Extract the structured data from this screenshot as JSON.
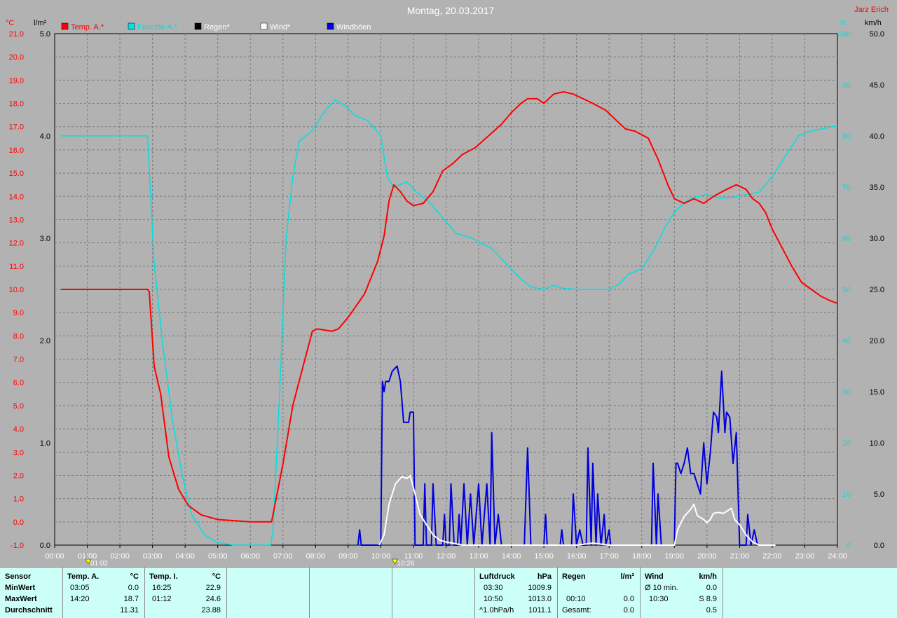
{
  "title": "Montag, 20.03.2017",
  "author": "Jarz Erich",
  "axes": {
    "left_temp": {
      "unit": "°C",
      "ticks": [
        "21.0",
        "20.0",
        "19.0",
        "18.0",
        "17.0",
        "16.0",
        "15.0",
        "14.0",
        "13.0",
        "12.0",
        "11.0",
        "10.0",
        "9.0",
        "8.0",
        "7.0",
        "6.0",
        "5.0",
        "4.0",
        "3.0",
        "2.0",
        "1.0",
        "0.0",
        "-1.0"
      ]
    },
    "left_rain": {
      "unit": "l/m²",
      "ticks": [
        "5.0",
        "4.0",
        "3.0",
        "2.0",
        "1.0",
        "0.0"
      ]
    },
    "right_hum": {
      "unit": "%",
      "ticks": [
        "100",
        "90",
        "80",
        "70",
        "60",
        "50",
        "40",
        "30",
        "20",
        "10",
        "0"
      ]
    },
    "right_wind": {
      "unit": "km/h",
      "ticks": [
        "50.0",
        "45.0",
        "40.0",
        "35.0",
        "30.0",
        "25.0",
        "20.0",
        "15.0",
        "10.0",
        "5.0",
        "0.0"
      ]
    },
    "x_ticks": [
      "00:00",
      "01:00",
      "02:00",
      "03:00",
      "04:00",
      "05:00",
      "06:00",
      "07:00",
      "08:00",
      "09:00",
      "10:00",
      "11:00",
      "12:00",
      "13:00",
      "14:00",
      "15:00",
      "16:00",
      "17:00",
      "18:00",
      "19:00",
      "20:00",
      "21:00",
      "22:00",
      "23:00",
      "24:00"
    ]
  },
  "markers": [
    {
      "label": "01:02",
      "hour": 1.03
    },
    {
      "label": "10:26",
      "hour": 10.43
    }
  ],
  "colors": {
    "temp": "#ff0000",
    "hum": "#00e0e0",
    "rain": "#000000",
    "wind": "#ffffff",
    "gust": "#0000dd",
    "grid": "#7a7a7a",
    "plot_bg": "#b2b2b2"
  },
  "chart_data": {
    "type": "line",
    "title": "Montag, 20.03.2017",
    "xlim": [
      0,
      24
    ],
    "legend": "top",
    "grid": true,
    "series": [
      {
        "name": "Temp. A.*",
        "axis": "temp",
        "ylim": [
          -1,
          21
        ],
        "points": [
          [
            0.2,
            10.0
          ],
          [
            2.85,
            10.0
          ],
          [
            2.9,
            9.9
          ],
          [
            3.05,
            6.7
          ],
          [
            3.25,
            5.5
          ],
          [
            3.5,
            2.8
          ],
          [
            3.8,
            1.4
          ],
          [
            4.1,
            0.7
          ],
          [
            4.5,
            0.3
          ],
          [
            5,
            0.1
          ],
          [
            6,
            0.0
          ],
          [
            6.65,
            0.0
          ],
          [
            7.0,
            2.5
          ],
          [
            7.3,
            5.0
          ],
          [
            7.6,
            6.6
          ],
          [
            7.9,
            8.2
          ],
          [
            8.05,
            8.3
          ],
          [
            8.5,
            8.2
          ],
          [
            8.7,
            8.3
          ],
          [
            9.0,
            8.8
          ],
          [
            9.5,
            9.8
          ],
          [
            9.9,
            11.2
          ],
          [
            10.1,
            12.3
          ],
          [
            10.25,
            13.8
          ],
          [
            10.4,
            14.5
          ],
          [
            10.6,
            14.2
          ],
          [
            10.8,
            13.8
          ],
          [
            11.0,
            13.6
          ],
          [
            11.3,
            13.7
          ],
          [
            11.6,
            14.2
          ],
          [
            11.9,
            15.1
          ],
          [
            12.2,
            15.4
          ],
          [
            12.5,
            15.8
          ],
          [
            12.9,
            16.1
          ],
          [
            13.3,
            16.6
          ],
          [
            13.7,
            17.1
          ],
          [
            14.0,
            17.6
          ],
          [
            14.3,
            18.0
          ],
          [
            14.5,
            18.2
          ],
          [
            14.8,
            18.2
          ],
          [
            15.0,
            18.0
          ],
          [
            15.3,
            18.4
          ],
          [
            15.6,
            18.5
          ],
          [
            15.9,
            18.4
          ],
          [
            16.2,
            18.2
          ],
          [
            16.5,
            18.0
          ],
          [
            16.9,
            17.7
          ],
          [
            17.2,
            17.3
          ],
          [
            17.5,
            16.9
          ],
          [
            17.8,
            16.8
          ],
          [
            18.2,
            16.5
          ],
          [
            18.5,
            15.6
          ],
          [
            18.8,
            14.5
          ],
          [
            19.0,
            13.9
          ],
          [
            19.3,
            13.7
          ],
          [
            19.6,
            13.9
          ],
          [
            19.9,
            13.7
          ],
          [
            20.2,
            14.0
          ],
          [
            20.6,
            14.3
          ],
          [
            20.9,
            14.5
          ],
          [
            21.2,
            14.3
          ],
          [
            21.4,
            13.9
          ],
          [
            21.6,
            13.7
          ],
          [
            21.8,
            13.3
          ],
          [
            22.0,
            12.6
          ],
          [
            22.3,
            11.8
          ],
          [
            22.6,
            11.0
          ],
          [
            22.9,
            10.3
          ],
          [
            23.2,
            10.0
          ],
          [
            23.5,
            9.7
          ],
          [
            23.8,
            9.5
          ],
          [
            24.0,
            9.4
          ]
        ]
      },
      {
        "name": "Feuchte A.*",
        "axis": "hum",
        "ylim": [
          0,
          100
        ],
        "points": [
          [
            0.2,
            80.0
          ],
          [
            2.85,
            80.0
          ],
          [
            3.05,
            55
          ],
          [
            3.3,
            40
          ],
          [
            3.6,
            25
          ],
          [
            3.9,
            14
          ],
          [
            4.2,
            6
          ],
          [
            4.6,
            2
          ],
          [
            5.0,
            0.5
          ],
          [
            5.5,
            0
          ],
          [
            6.62,
            0
          ],
          [
            6.7,
            3
          ],
          [
            6.9,
            30
          ],
          [
            7.1,
            60
          ],
          [
            7.3,
            72
          ],
          [
            7.5,
            79
          ],
          [
            7.9,
            81
          ],
          [
            8.3,
            85
          ],
          [
            8.6,
            87
          ],
          [
            8.9,
            86
          ],
          [
            9.2,
            84
          ],
          [
            9.6,
            83
          ],
          [
            10.0,
            80
          ],
          [
            10.2,
            72
          ],
          [
            10.4,
            70
          ],
          [
            10.8,
            71
          ],
          [
            11.1,
            69
          ],
          [
            11.5,
            67
          ],
          [
            11.9,
            64
          ],
          [
            12.3,
            61
          ],
          [
            12.8,
            60
          ],
          [
            13.1,
            59
          ],
          [
            13.4,
            58
          ],
          [
            13.7,
            56
          ],
          [
            14.0,
            54
          ],
          [
            14.3,
            52
          ],
          [
            14.6,
            50.5
          ],
          [
            15.0,
            50
          ],
          [
            15.3,
            50.8
          ],
          [
            15.6,
            50.2
          ],
          [
            16.0,
            50
          ],
          [
            16.5,
            50
          ],
          [
            17.0,
            50
          ],
          [
            17.3,
            51
          ],
          [
            17.6,
            53
          ],
          [
            18.0,
            54
          ],
          [
            18.4,
            58
          ],
          [
            18.7,
            62
          ],
          [
            19.0,
            65
          ],
          [
            19.3,
            67
          ],
          [
            19.6,
            68
          ],
          [
            20.0,
            68.5
          ],
          [
            20.4,
            67.8
          ],
          [
            20.8,
            68
          ],
          [
            21.2,
            68.5
          ],
          [
            21.6,
            69
          ],
          [
            22.0,
            72
          ],
          [
            22.4,
            76
          ],
          [
            22.8,
            80
          ],
          [
            23.2,
            81
          ],
          [
            23.6,
            81.5
          ],
          [
            24.0,
            82
          ]
        ]
      },
      {
        "name": "Regen*",
        "axis": "rain",
        "ylim": [
          0,
          5
        ],
        "points": []
      },
      {
        "name": "Wind*",
        "axis": "wind",
        "ylim": [
          0,
          50
        ],
        "points": [
          [
            9.95,
            0
          ],
          [
            10.1,
            1
          ],
          [
            10.25,
            4
          ],
          [
            10.45,
            6
          ],
          [
            10.65,
            6.7
          ],
          [
            10.8,
            6.5
          ],
          [
            10.9,
            6.8
          ],
          [
            11.05,
            5
          ],
          [
            11.2,
            3
          ],
          [
            11.4,
            2
          ],
          [
            11.6,
            1
          ],
          [
            11.8,
            0.5
          ],
          [
            12.0,
            0.3
          ],
          [
            12.2,
            0.2
          ],
          [
            12.5,
            0
          ],
          [
            13.4,
            0
          ],
          [
            14.0,
            0
          ],
          [
            14.5,
            0
          ],
          [
            15.0,
            0
          ],
          [
            16.0,
            0
          ],
          [
            16.5,
            0.2
          ],
          [
            17.0,
            0
          ],
          [
            19.0,
            0
          ],
          [
            19.1,
            1.5
          ],
          [
            19.3,
            2.8
          ],
          [
            19.5,
            3.5
          ],
          [
            19.6,
            4.0
          ],
          [
            19.7,
            2.9
          ],
          [
            19.9,
            2.5
          ],
          [
            20.0,
            2.2
          ],
          [
            20.1,
            2.5
          ],
          [
            20.2,
            3.1
          ],
          [
            20.35,
            3.2
          ],
          [
            20.5,
            3.1
          ],
          [
            20.6,
            3.3
          ],
          [
            20.75,
            3.6
          ],
          [
            20.85,
            2.5
          ],
          [
            21.0,
            2.0
          ],
          [
            21.2,
            1.0
          ],
          [
            21.4,
            0.3
          ],
          [
            21.6,
            0
          ],
          [
            22.1,
            0
          ]
        ]
      },
      {
        "name": "Windböen",
        "axis": "wind",
        "ylim": [
          0,
          50
        ],
        "points": [
          [
            9.3,
            0
          ],
          [
            9.35,
            1.5
          ],
          [
            9.4,
            0
          ],
          [
            10.0,
            0
          ],
          [
            10.05,
            16
          ],
          [
            10.1,
            15
          ],
          [
            10.15,
            16
          ],
          [
            10.25,
            16
          ],
          [
            10.35,
            17
          ],
          [
            10.5,
            17.5
          ],
          [
            10.6,
            16
          ],
          [
            10.7,
            12
          ],
          [
            10.85,
            12
          ],
          [
            10.9,
            13
          ],
          [
            11.0,
            13
          ],
          [
            11.05,
            0
          ],
          [
            11.3,
            0
          ],
          [
            11.35,
            6
          ],
          [
            11.4,
            0
          ],
          [
            11.55,
            0
          ],
          [
            11.6,
            6
          ],
          [
            11.7,
            0
          ],
          [
            11.9,
            0
          ],
          [
            11.95,
            3
          ],
          [
            12.0,
            0
          ],
          [
            12.1,
            0
          ],
          [
            12.15,
            6
          ],
          [
            12.25,
            0
          ],
          [
            12.35,
            0
          ],
          [
            12.4,
            3
          ],
          [
            12.45,
            0
          ],
          [
            12.55,
            6
          ],
          [
            12.65,
            0
          ],
          [
            12.75,
            5
          ],
          [
            12.85,
            0
          ],
          [
            13.0,
            6
          ],
          [
            13.1,
            0
          ],
          [
            13.25,
            6
          ],
          [
            13.35,
            0
          ],
          [
            13.4,
            11
          ],
          [
            13.5,
            0
          ],
          [
            13.6,
            3
          ],
          [
            13.7,
            0
          ],
          [
            14.4,
            0
          ],
          [
            14.5,
            9.5
          ],
          [
            14.6,
            0
          ],
          [
            15.0,
            0
          ],
          [
            15.05,
            3
          ],
          [
            15.1,
            0
          ],
          [
            15.5,
            0
          ],
          [
            15.55,
            1.5
          ],
          [
            15.6,
            0
          ],
          [
            15.85,
            0
          ],
          [
            15.9,
            5
          ],
          [
            16.0,
            0
          ],
          [
            16.1,
            1.5
          ],
          [
            16.2,
            0
          ],
          [
            16.3,
            0
          ],
          [
            16.35,
            9.5
          ],
          [
            16.45,
            0
          ],
          [
            16.5,
            8
          ],
          [
            16.6,
            0
          ],
          [
            16.65,
            5
          ],
          [
            16.75,
            0
          ],
          [
            16.85,
            3
          ],
          [
            16.9,
            0
          ],
          [
            17.0,
            1.5
          ],
          [
            17.05,
            0
          ],
          [
            18.3,
            0
          ],
          [
            18.35,
            8
          ],
          [
            18.45,
            0
          ],
          [
            18.5,
            5
          ],
          [
            18.6,
            0
          ],
          [
            19.0,
            0
          ],
          [
            19.05,
            8
          ],
          [
            19.1,
            8
          ],
          [
            19.2,
            7
          ],
          [
            19.3,
            8
          ],
          [
            19.4,
            9.5
          ],
          [
            19.5,
            7
          ],
          [
            19.6,
            7
          ],
          [
            19.7,
            6
          ],
          [
            19.8,
            5
          ],
          [
            19.9,
            10
          ],
          [
            20.0,
            6
          ],
          [
            20.1,
            9
          ],
          [
            20.2,
            13
          ],
          [
            20.3,
            12.5
          ],
          [
            20.35,
            11
          ],
          [
            20.45,
            17
          ],
          [
            20.55,
            11
          ],
          [
            20.6,
            13
          ],
          [
            20.7,
            12.5
          ],
          [
            20.8,
            8
          ],
          [
            20.9,
            11
          ],
          [
            21.0,
            0
          ],
          [
            21.2,
            0
          ],
          [
            21.25,
            3
          ],
          [
            21.35,
            0
          ],
          [
            21.45,
            1.5
          ],
          [
            21.55,
            0
          ]
        ]
      }
    ]
  },
  "panel": {
    "sensor": {
      "h": "Sensor",
      "min": "MinWert",
      "max": "MaxWert",
      "avg": "Durchschnitt"
    },
    "temp_a": {
      "h": "Temp. A.",
      "unit": "°C",
      "min_t": "03:05",
      "min_v": "0.0",
      "max_t": "14:20",
      "max_v": "18.7",
      "avg": "11.31"
    },
    "temp_i": {
      "h": "Temp. I.",
      "unit": "°C",
      "min_t": "16:25",
      "min_v": "22.9",
      "max_t": "01:12",
      "max_v": "24.6",
      "avg": "23.88"
    },
    "luft": {
      "h": "Luftdruck",
      "unit": "hPa",
      "min_t": "03:30",
      "min_v": "1009.9",
      "max_t": "10:50",
      "max_v": "1013.0",
      "avg_l": "^1.0hPa/h",
      "avg": "1011.1"
    },
    "regen": {
      "h": "Regen",
      "unit": "l/m²",
      "max_t": "00:10",
      "max_v": "0.0",
      "avg_l": "Gesamt:",
      "avg": "0.0"
    },
    "wind": {
      "h": "Wind",
      "unit": "km/h",
      "min_t": "Ø 10 min.",
      "min_v": "0.0",
      "max_t": "10:30",
      "max_v": "S 8.9",
      "avg": "0.5"
    }
  }
}
